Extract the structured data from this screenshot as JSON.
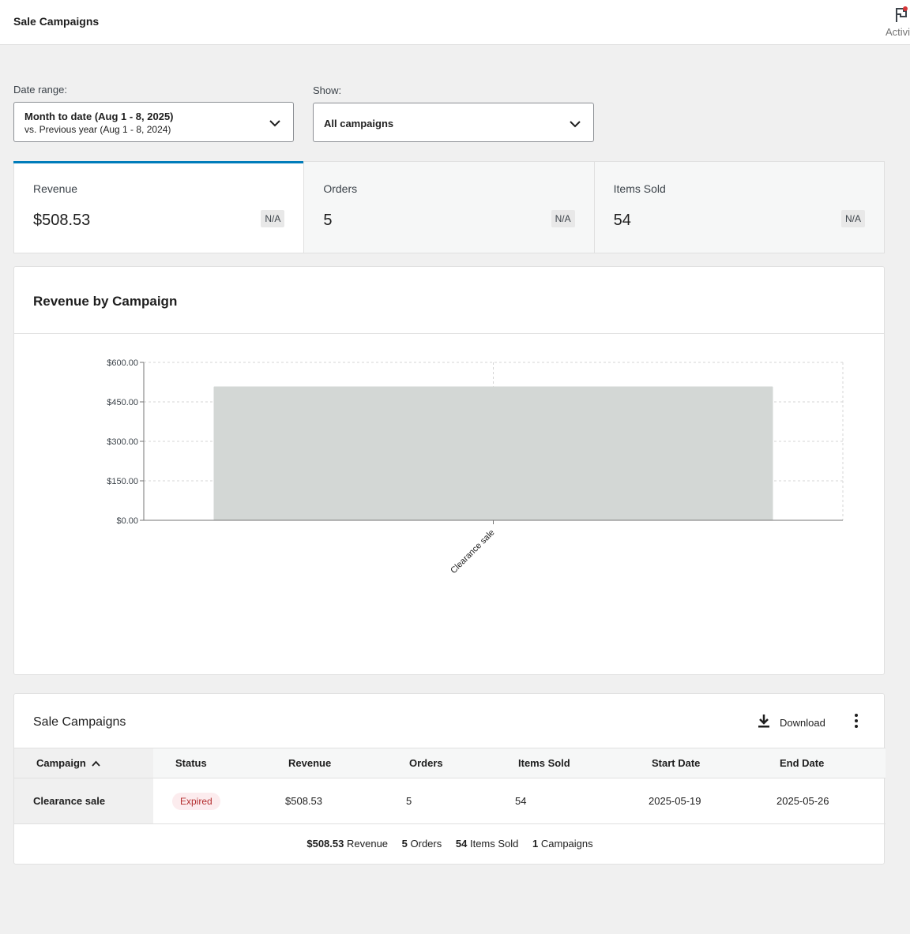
{
  "header": {
    "title": "Sale Campaigns",
    "activity_label": "Activi",
    "activity_icon": "flag-icon"
  },
  "filters": {
    "date_range": {
      "label": "Date range:",
      "primary": "Month to date (Aug 1 - 8, 2025)",
      "secondary": "vs. Previous year (Aug 1 - 8, 2024)"
    },
    "show": {
      "label": "Show:",
      "value": "All campaigns"
    }
  },
  "summary": [
    {
      "label": "Revenue",
      "value": "$508.53",
      "delta": "N/A"
    },
    {
      "label": "Orders",
      "value": "5",
      "delta": "N/A"
    },
    {
      "label": "Items Sold",
      "value": "54",
      "delta": "N/A"
    }
  ],
  "chart": {
    "title": "Revenue by Campaign",
    "bar_color": "#d3d7d5"
  },
  "chart_data": {
    "type": "bar",
    "categories": [
      "Clearance sale"
    ],
    "values": [
      508.53
    ],
    "title": "Revenue by Campaign",
    "xlabel": "",
    "ylabel": "",
    "ylim": [
      0,
      600
    ],
    "yticks": [
      0,
      150,
      300,
      450,
      600
    ],
    "ytick_labels": [
      "$0.00",
      "$150.00",
      "$300.00",
      "$450.00",
      "$600.00"
    ],
    "grid": true
  },
  "table": {
    "title": "Sale Campaigns",
    "download_label": "Download",
    "columns": [
      "Campaign",
      "Status",
      "Revenue",
      "Orders",
      "Items Sold",
      "Start Date",
      "End Date"
    ],
    "rows": [
      {
        "campaign": "Clearance sale",
        "status": "Expired",
        "revenue": "$508.53",
        "orders": "5",
        "items_sold": "54",
        "start_date": "2025-05-19",
        "end_date": "2025-05-26"
      }
    ],
    "totals": {
      "revenue_value": "$508.53",
      "revenue_label": "Revenue",
      "orders_value": "5",
      "orders_label": "Orders",
      "items_value": "54",
      "items_label": "Items Sold",
      "campaigns_value": "1",
      "campaigns_label": "Campaigns"
    }
  }
}
